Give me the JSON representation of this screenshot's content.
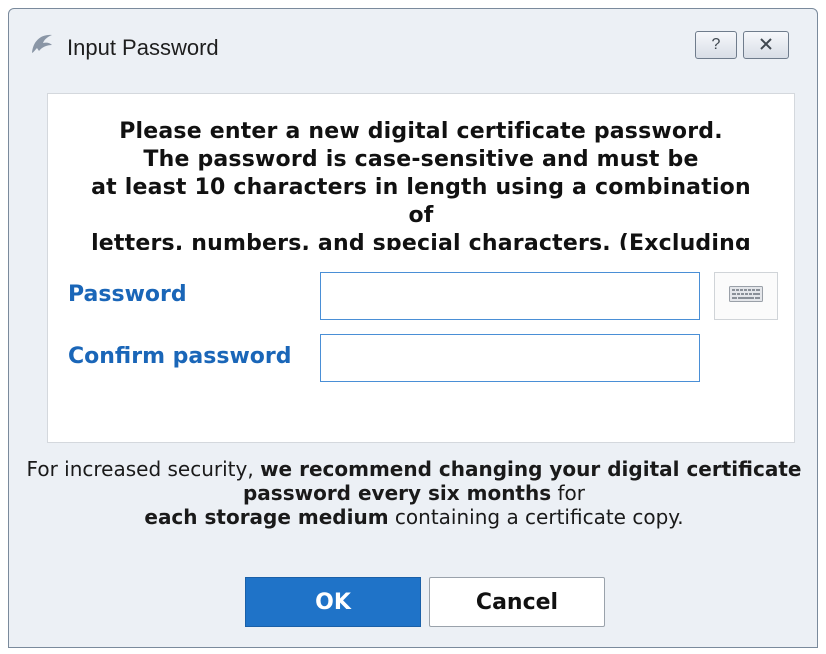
{
  "window": {
    "title": "Input Password",
    "help_glyph": "?",
    "close_glyph": "X"
  },
  "notice": {
    "lines": [
      "Please enter a new digital certificate password.",
      "The password is case-sensitive and must be",
      "at least 10 characters in length using a combination",
      "of",
      "letters, numbers, and special characters. (Excluding"
    ]
  },
  "form": {
    "password_label": "Password",
    "confirm_label": "Confirm password",
    "password_value": "",
    "confirm_value": ""
  },
  "security": {
    "part1": "For increased security, ",
    "part2": "we recommend changing your digital certificate password every six months",
    "part3": " for ",
    "part4": "each storage medium",
    "part5": " containing a certificate copy."
  },
  "buttons": {
    "ok": "OK",
    "cancel": "Cancel"
  },
  "icons": {
    "app": "dolphin-icon",
    "keyboard": "keyboard-icon"
  },
  "colors": {
    "accent": "#1f73c8",
    "label": "#1a66b8"
  }
}
